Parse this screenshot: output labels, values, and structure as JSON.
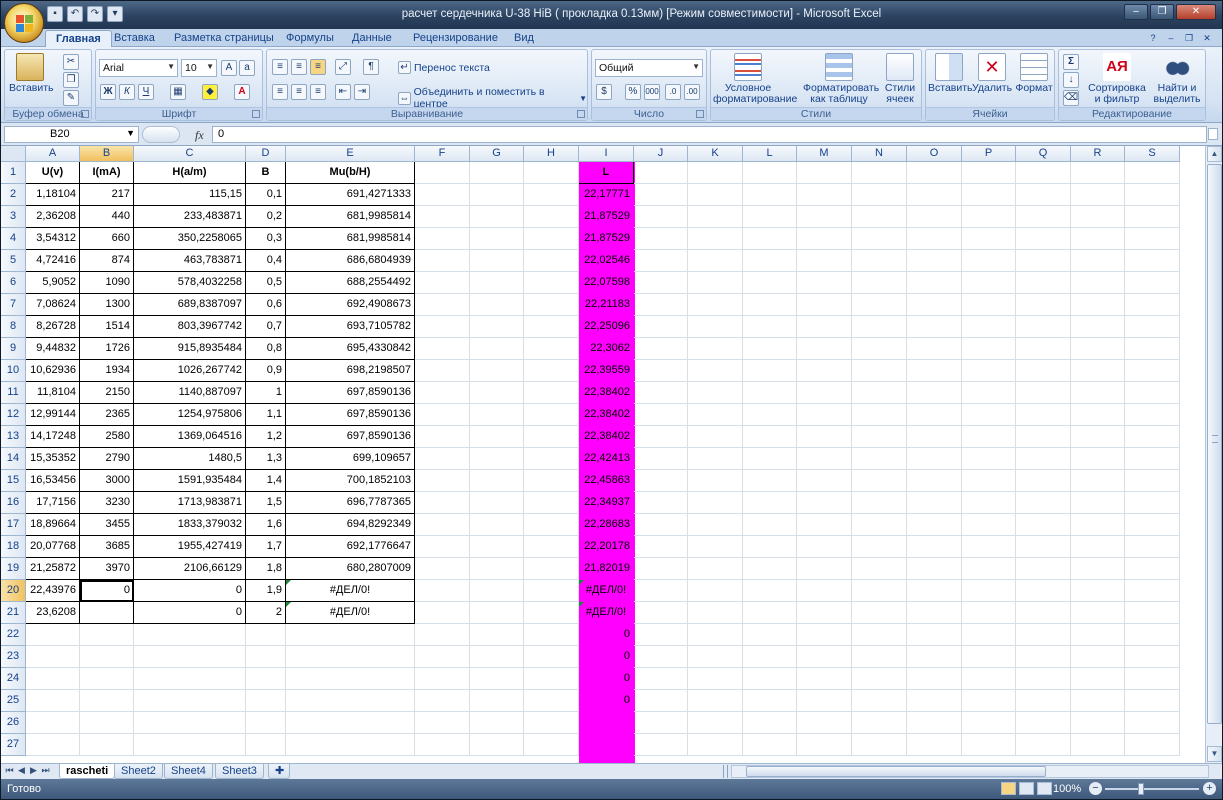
{
  "window": {
    "title": "расчет сердечника U-38 HiB ( прокладка 0.13мм)  [Режим совместимости] - Microsoft Excel"
  },
  "ribbon_tabs": [
    "Главная",
    "Вставка",
    "Разметка страницы",
    "Формулы",
    "Данные",
    "Рецензирование",
    "Вид"
  ],
  "ribbon": {
    "clipboard": {
      "paste": "Вставить",
      "label": "Буфер обмена"
    },
    "font": {
      "name": "Arial",
      "size": "10",
      "label": "Шрифт",
      "bold": "Ж",
      "italic": "К",
      "underline": "Ч"
    },
    "alignment": {
      "wrap": "Перенос текста",
      "merge": "Объединить и поместить в центре",
      "label": "Выравнивание"
    },
    "number": {
      "format": "Общий",
      "label": "Число",
      "percent": "%",
      "thousands": "000"
    },
    "styles": {
      "conditional": "Условное форматирование",
      "as_table": "Форматировать как таблицу",
      "cell_styles": "Стили ячеек",
      "label": "Стили"
    },
    "cells": {
      "insert": "Вставить",
      "delete": "Удалить",
      "format": "Формат",
      "label": "Ячейки"
    },
    "editing": {
      "sort": "Сортировка и фильтр",
      "find": "Найти и выделить",
      "label": "Редактирование",
      "sum": "Σ"
    }
  },
  "formula_bar": {
    "name_box": "B20",
    "fx": "fx",
    "value": "0"
  },
  "columns": [
    "A",
    "B",
    "C",
    "D",
    "E",
    "F",
    "G",
    "H",
    "I",
    "J",
    "K",
    "L",
    "M",
    "N",
    "O",
    "P",
    "Q",
    "R",
    "S"
  ],
  "headers": {
    "A": "U(v)",
    "B": "I(mA)",
    "C": "H(a/m)",
    "D": "B",
    "E": "Mu(b/H)",
    "I": "L"
  },
  "rows": [
    {
      "A": "1,18104",
      "B": "217",
      "C": "115,15",
      "D": "0,1",
      "E": "691,4271333",
      "I": "22,17771"
    },
    {
      "A": "2,36208",
      "B": "440",
      "C": "233,483871",
      "D": "0,2",
      "E": "681,9985814",
      "I": "21,87529"
    },
    {
      "A": "3,54312",
      "B": "660",
      "C": "350,2258065",
      "D": "0,3",
      "E": "681,9985814",
      "I": "21,87529"
    },
    {
      "A": "4,72416",
      "B": "874",
      "C": "463,783871",
      "D": "0,4",
      "E": "686,6804939",
      "I": "22,02546"
    },
    {
      "A": "5,9052",
      "B": "1090",
      "C": "578,4032258",
      "D": "0,5",
      "E": "688,2554492",
      "I": "22,07598"
    },
    {
      "A": "7,08624",
      "B": "1300",
      "C": "689,8387097",
      "D": "0,6",
      "E": "692,4908673",
      "I": "22,21183"
    },
    {
      "A": "8,26728",
      "B": "1514",
      "C": "803,3967742",
      "D": "0,7",
      "E": "693,7105782",
      "I": "22,25096"
    },
    {
      "A": "9,44832",
      "B": "1726",
      "C": "915,8935484",
      "D": "0,8",
      "E": "695,4330842",
      "I": "22,3062"
    },
    {
      "A": "10,62936",
      "B": "1934",
      "C": "1026,267742",
      "D": "0,9",
      "E": "698,2198507",
      "I": "22,39559"
    },
    {
      "A": "11,8104",
      "B": "2150",
      "C": "1140,887097",
      "D": "1",
      "E": "697,8590136",
      "I": "22,38402"
    },
    {
      "A": "12,99144",
      "B": "2365",
      "C": "1254,975806",
      "D": "1,1",
      "E": "697,8590136",
      "I": "22,38402"
    },
    {
      "A": "14,17248",
      "B": "2580",
      "C": "1369,064516",
      "D": "1,2",
      "E": "697,8590136",
      "I": "22,38402"
    },
    {
      "A": "15,35352",
      "B": "2790",
      "C": "1480,5",
      "D": "1,3",
      "E": "699,109657",
      "I": "22,42413"
    },
    {
      "A": "16,53456",
      "B": "3000",
      "C": "1591,935484",
      "D": "1,4",
      "E": "700,1852103",
      "I": "22,45863"
    },
    {
      "A": "17,7156",
      "B": "3230",
      "C": "1713,983871",
      "D": "1,5",
      "E": "696,7787365",
      "I": "22,34937"
    },
    {
      "A": "18,89664",
      "B": "3455",
      "C": "1833,379032",
      "D": "1,6",
      "E": "694,8292349",
      "I": "22,28683"
    },
    {
      "A": "20,07768",
      "B": "3685",
      "C": "1955,427419",
      "D": "1,7",
      "E": "692,1776647",
      "I": "22,20178"
    },
    {
      "A": "21,25872",
      "B": "3970",
      "C": "2106,66129",
      "D": "1,8",
      "E": "680,2807009",
      "I": "21,82019"
    },
    {
      "A": "22,43976",
      "B": "0",
      "C": "0",
      "D": "1,9",
      "E": "#ДЕЛ/0!",
      "I": "#ДЕЛ/0!"
    },
    {
      "A": "23,6208",
      "B": "",
      "C": "0",
      "D": "2",
      "E": "#ДЕЛ/0!",
      "I": "#ДЕЛ/0!"
    },
    {
      "I": "0"
    },
    {
      "I": "0"
    },
    {
      "I": "0"
    },
    {
      "I": "0"
    },
    {},
    {}
  ],
  "sheet_tabs": [
    "rascheti",
    "Sheet2",
    "Sheet4",
    "Sheet3"
  ],
  "status": {
    "ready": "Готово",
    "zoom": "100%"
  },
  "colors": {
    "highlight": "#ff00ff",
    "ribbon": "#dae6f4",
    "title_bar": "#2b4260"
  }
}
